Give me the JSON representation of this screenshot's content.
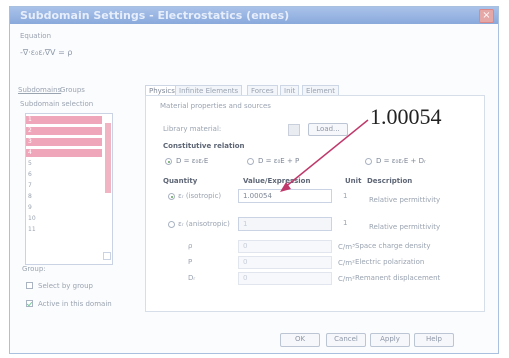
{
  "window": {
    "title": "Subdomain Settings - Electrostatics (emes)",
    "close_glyph": "×"
  },
  "equation": {
    "label": "Equation",
    "text": "-∇·ε₀εᵣ∇V = ρ"
  },
  "left_tabs": [
    "Subdomains",
    "Groups"
  ],
  "subdomain_selection": {
    "label": "Subdomain selection",
    "items": [
      "1",
      "2",
      "3",
      "4",
      "5",
      "6",
      "7",
      "8",
      "9",
      "10",
      "11"
    ],
    "selected": [
      0,
      1,
      2,
      3
    ]
  },
  "group": {
    "label": "Group:",
    "select_by_group": "Select by group",
    "active_domain": "Active in this domain",
    "active_checked": true
  },
  "tabs": [
    "Physics",
    "Infinite Elements",
    "Forces",
    "Init",
    "Element"
  ],
  "material": {
    "section": "Material properties and sources",
    "library_label": "Library material:",
    "load_button": "Load..."
  },
  "constitutive": {
    "title": "Constitutive relation",
    "options": [
      "D = ε₀εᵣE",
      "D = ε₀E + P",
      "D = ε₀εᵣE + Dᵣ"
    ],
    "selected_index": 0
  },
  "table": {
    "headers": {
      "quantity": "Quantity",
      "value": "Value/Expression",
      "unit": "Unit",
      "description": "Description"
    },
    "rows": [
      {
        "quantity": "εᵣ (isotropic)",
        "value": "1.00054",
        "unit": "1",
        "description": "Relative permittivity",
        "selected": true
      },
      {
        "quantity": "εᵣ (anisotropic)",
        "value": "1",
        "unit": "1",
        "description": "Relative permittivity",
        "selected": false
      },
      {
        "quantity": "ρ",
        "value": "0",
        "unit": "C/m³",
        "description": "Space charge density"
      },
      {
        "quantity": "P",
        "value": "0",
        "unit": "C/m²",
        "description": "Electric polarization"
      },
      {
        "quantity": "Dᵣ",
        "value": "0",
        "unit": "C/m²",
        "description": "Remanent displacement"
      }
    ]
  },
  "annotation": {
    "text": "1.00054",
    "color": "#c0386a"
  },
  "buttons": {
    "ok": "OK",
    "cancel": "Cancel",
    "apply": "Apply",
    "help": "Help"
  }
}
